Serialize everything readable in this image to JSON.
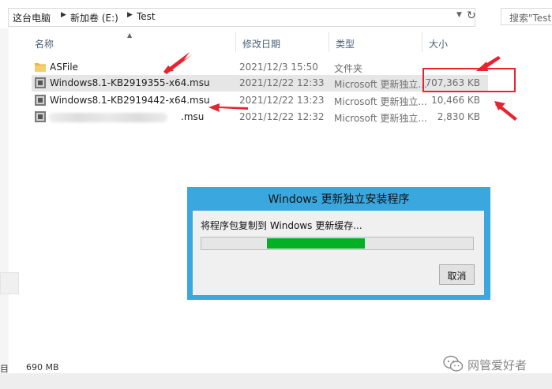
{
  "address": {
    "crumbs": [
      "这台电脑",
      "新加卷 (E:)",
      "Test"
    ],
    "search_placeholder": "搜索\"Test\""
  },
  "columns": {
    "name": "名称",
    "date": "修改日期",
    "type": "类型",
    "size": "大小"
  },
  "files": [
    {
      "name": "ASFile",
      "date": "2021/12/3 15:50",
      "type": "文件夹",
      "size": "",
      "icon": "folder-icon"
    },
    {
      "name": "Windows8.1-KB2919355-x64.msu",
      "date": "2021/12/22 12:33",
      "type": "Microsoft 更新独立...",
      "size": "707,363 KB",
      "icon": "msu-file-icon"
    },
    {
      "name": "Windows8.1-KB2919442-x64.msu",
      "date": "2021/12/22 13:23",
      "type": "Microsoft 更新独立...",
      "size": "10,466 KB",
      "icon": "msu-file-icon"
    },
    {
      "name_visible_suffix": "msu",
      "date": "2021/12/22 12:32",
      "type": "Microsoft 更新独立...",
      "size": "2,830 KB",
      "icon": "msu-file-icon"
    }
  ],
  "dialog": {
    "title": "Windows 更新独立安装程序",
    "message": "将程序包复制到 Windows 更新缓存...",
    "progress_start": 0.24,
    "progress_end": 0.6,
    "cancel": "取消"
  },
  "status": {
    "selected_prefix": "目",
    "size": "690 MB"
  },
  "watermark": {
    "text": "网管爱好者"
  },
  "colors": {
    "accent_annotation": "#e8232f",
    "dialog_frame": "#3ba7df",
    "progress": "#06b025"
  }
}
